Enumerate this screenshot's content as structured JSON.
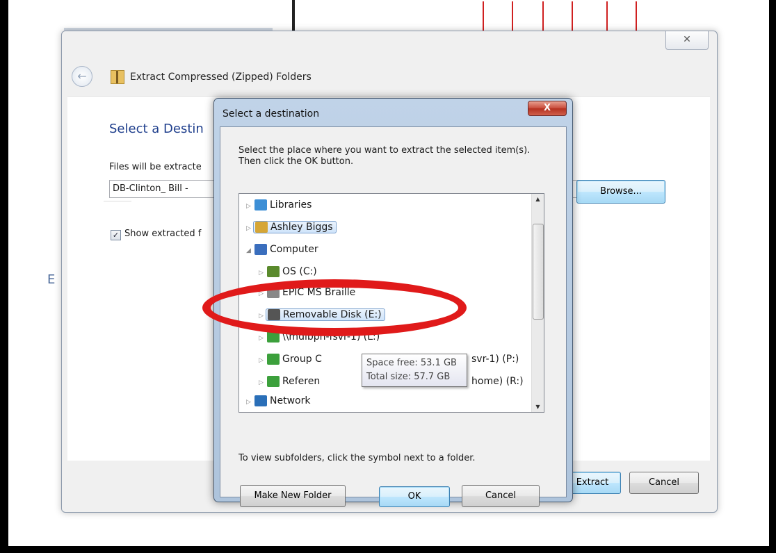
{
  "wizard": {
    "close_glyph": "✕",
    "title": "Extract Compressed (Zipped) Folders",
    "heading": "Select a Destin",
    "files_label": "Files will be extracte",
    "path_value": "DB-Clinton_ Bill - ",
    "browse_label": "Browse...",
    "show_checkbox_label": "Show extracted f",
    "checked": true,
    "extract_label": "Extract",
    "cancel_label": "Cancel",
    "bg_letter": "E"
  },
  "dialog": {
    "title": "Select a destination",
    "close_glyph": "X",
    "instruction": "Select the place where you want to extract the selected item(s).  Then click the OK button.",
    "tree": [
      {
        "label": "Libraries",
        "icon": "libraries-icon",
        "color": "#3d8fd6",
        "exp": "▷",
        "indent": 0,
        "selected": false
      },
      {
        "label": "Ashley Biggs",
        "icon": "user-folder-icon",
        "color": "#d6a636",
        "exp": "▷",
        "indent": 0,
        "selected": true
      },
      {
        "label": "Computer",
        "icon": "computer-icon",
        "color": "#3a6ebd",
        "exp": "◢",
        "indent": 0,
        "selected": false
      },
      {
        "label": "OS (C:)",
        "icon": "windows-drive-icon",
        "color": "#5a8a2c",
        "exp": "▷",
        "indent": 1,
        "selected": false
      },
      {
        "label": "EPIC MS Braille",
        "icon": "drive-icon",
        "color": "#888888",
        "exp": "▷",
        "indent": 1,
        "selected": false
      },
      {
        "label": "Removable Disk (E:)",
        "icon": "removable-disk-icon",
        "color": "#555555",
        "exp": "▷",
        "indent": 1,
        "selected": true
      },
      {
        "label": "\\\\mdibph-fsvr-1) (L:)",
        "icon": "network-drive-icon",
        "color": "#3ca03c",
        "exp": "▷",
        "indent": 1,
        "selected": false
      },
      {
        "label": "Group C",
        "icon": "network-drive-icon",
        "color": "#3ca03c",
        "exp": "▷",
        "indent": 1,
        "selected": false
      },
      {
        "label": "Referen",
        "icon": "network-drive-icon",
        "color": "#3ca03c",
        "exp": "▷",
        "indent": 1,
        "selected": false
      },
      {
        "label": "Network",
        "icon": "network-icon",
        "color": "#2a6fb8",
        "exp": "▷",
        "indent": 0,
        "selected": false
      }
    ],
    "tree_tails": {
      "group": "svr-1) (P:)",
      "reference": "home) (R:)"
    },
    "tooltip": {
      "space_free": "Space free: 53.1 GB",
      "total_size": "Total size: 57.7 GB"
    },
    "hint": "To view subfolders, click the symbol next to a folder.",
    "make_new_folder_label": "Make New Folder",
    "ok_label": "OK",
    "cancel_label": "Cancel"
  },
  "colors": {
    "highlight_ellipse": "#e01a1a",
    "heading_blue": "#1e3e8c"
  }
}
